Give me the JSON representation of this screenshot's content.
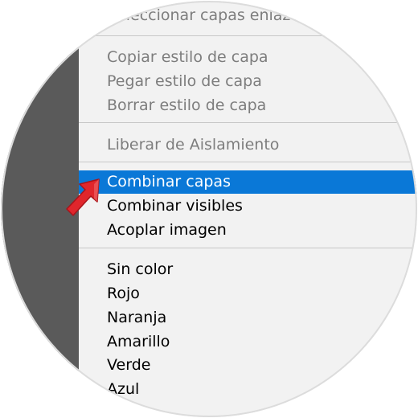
{
  "menu": {
    "top_item": "Seleccionar capas enlazadas",
    "group1": [
      "Copiar estilo de capa",
      "Pegar estilo de capa",
      "Borrar estilo de capa"
    ],
    "group2": [
      "Liberar de Aislamiento"
    ],
    "group3": {
      "selected": "Combinar capas",
      "others": [
        "Combinar visibles",
        "Acoplar imagen"
      ]
    },
    "colors": [
      "Sin color",
      "Rojo",
      "Naranja",
      "Amarillo",
      "Verde",
      "Azul"
    ]
  },
  "theme": {
    "selection_color": "#0a78d7",
    "menu_bg": "#f2f2f2",
    "panel_bg": "#5a5a5a",
    "arrow_color": "#e0262c"
  },
  "icons": [
    "pointer-arrow-icon"
  ]
}
